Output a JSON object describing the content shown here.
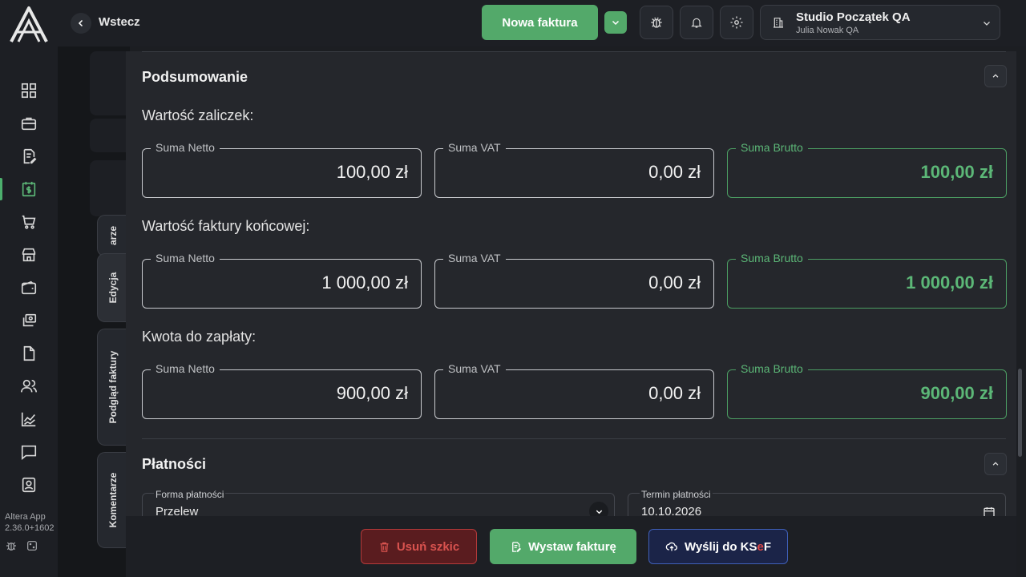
{
  "app": {
    "name": "Altera App",
    "version": "2.36.0+1602"
  },
  "header": {
    "back_label": "Wstecz",
    "new_invoice_label": "Nowa faktura",
    "company_name": "Studio Początek QA",
    "company_user": "Julia Nowak QA"
  },
  "nav": {
    "items": [
      {
        "name": "dashboard-icon"
      },
      {
        "name": "briefcase-icon"
      },
      {
        "name": "document-edit-icon"
      },
      {
        "name": "invoice-dollar-icon",
        "active": true
      },
      {
        "name": "cart-icon"
      },
      {
        "name": "store-icon"
      },
      {
        "name": "wallet-icon"
      },
      {
        "name": "exchange-icon"
      },
      {
        "name": "file-icon"
      },
      {
        "name": "users-icon"
      },
      {
        "name": "chart-icon"
      },
      {
        "name": "chat-icon"
      },
      {
        "name": "contact-icon"
      }
    ]
  },
  "side_tabs": {
    "partial": "arze",
    "edit": "Edycja",
    "preview": "Podgląd faktury",
    "comments": "Komentarze"
  },
  "summary": {
    "title": "Podsumowanie",
    "groups": [
      {
        "label": "Wartość zaliczek:",
        "netto_label": "Suma Netto",
        "netto": "100,00 zł",
        "vat_label": "Suma VAT",
        "vat": "0,00 zł",
        "brutto_label": "Suma Brutto",
        "brutto": "100,00 zł"
      },
      {
        "label": "Wartość faktury końcowej:",
        "netto_label": "Suma Netto",
        "netto": "1 000,00 zł",
        "vat_label": "Suma VAT",
        "vat": "0,00 zł",
        "brutto_label": "Suma Brutto",
        "brutto": "1 000,00 zł"
      },
      {
        "label": "Kwota do zapłaty:",
        "netto_label": "Suma Netto",
        "netto": "900,00 zł",
        "vat_label": "Suma VAT",
        "vat": "0,00 zł",
        "brutto_label": "Suma Brutto",
        "brutto": "900,00 zł"
      }
    ]
  },
  "payments": {
    "title": "Płatności",
    "method_label": "Forma płatności",
    "method_value": "Przelew",
    "due_label": "Termin płatności",
    "due_value": "10.10.2026"
  },
  "footer": {
    "delete_label": "Usuń szkic",
    "issue_label": "Wystaw fakturę",
    "ksef_label_pre": "Wyślij do KS",
    "ksef_label_e": "e",
    "ksef_label_post": "F"
  },
  "colors": {
    "accent": "#53a96a",
    "danger": "#d9534f",
    "ksef_blue": "#1b2448"
  }
}
